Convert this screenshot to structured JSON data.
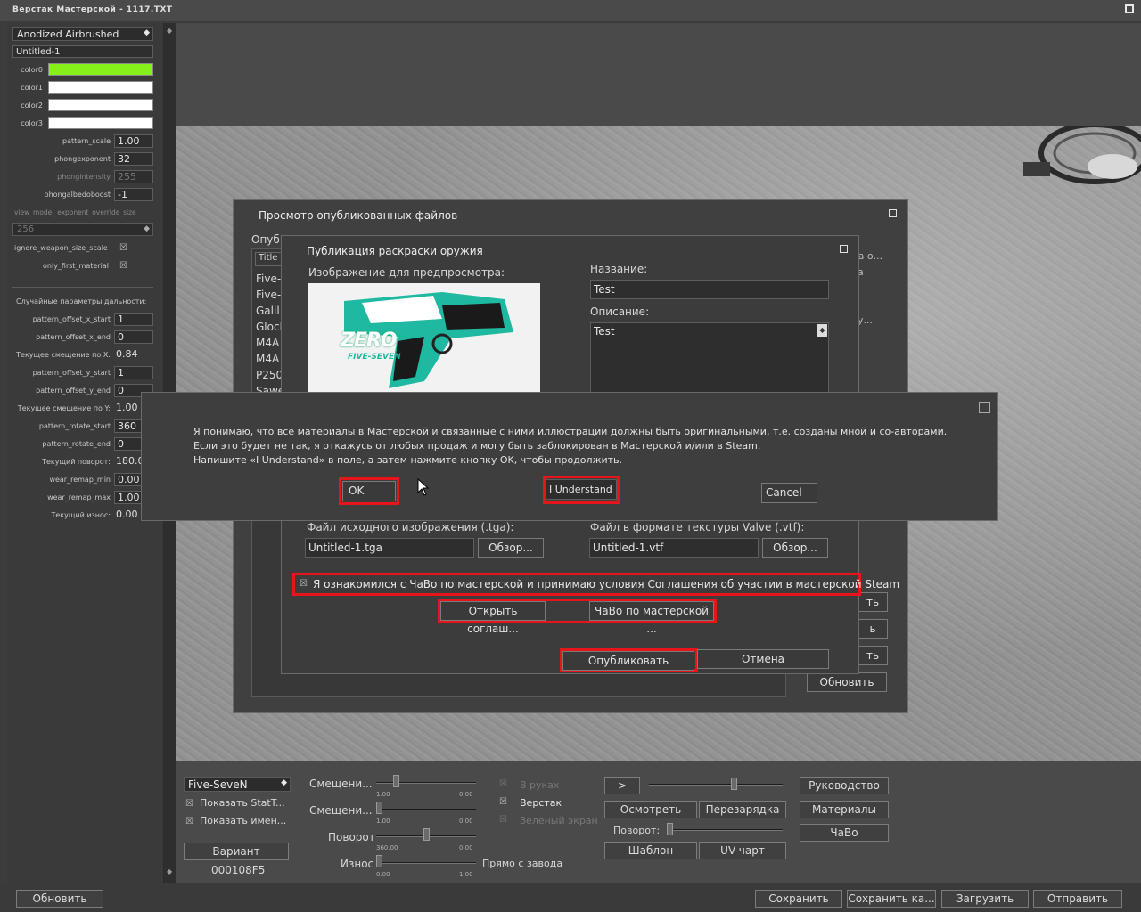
{
  "window": {
    "title": "Верстак Мастерской - 1117.TXT"
  },
  "left_panel": {
    "finish_style": "Anodized Airbrushed",
    "file_name": "Untitled-1",
    "colors": [
      {
        "label": "color0",
        "hex": "#86f01a"
      },
      {
        "label": "color1",
        "hex": "#ffffff"
      },
      {
        "label": "color2",
        "hex": "#ffffff"
      },
      {
        "label": "color3",
        "hex": "#ffffff"
      }
    ],
    "params": [
      {
        "label": "pattern_scale",
        "value": "1.00"
      },
      {
        "label": "phongexponent",
        "value": "32"
      },
      {
        "label": "phongintensity",
        "value": "255"
      },
      {
        "label": "phongalbedoboost",
        "value": "-1"
      }
    ],
    "view_model_label": "view_model_exponent_override_size",
    "view_model_value": "256",
    "ignore_label": "ignore_weapon_size_scale",
    "only_first_label": "only_first_material",
    "random_header": "Случайные параметры дальности:",
    "ranges": [
      {
        "label": "pattern_offset_x_start",
        "value": "1",
        "kind": "field"
      },
      {
        "label": "pattern_offset_x_end",
        "value": "0",
        "kind": "field"
      },
      {
        "label": "Текущее смещение по X:",
        "value": "0.84",
        "kind": "text"
      },
      {
        "label": "pattern_offset_y_start",
        "value": "1",
        "kind": "field"
      },
      {
        "label": "pattern_offset_y_end",
        "value": "0",
        "kind": "field"
      },
      {
        "label": "Текущее смещение по Y:",
        "value": "1.00",
        "kind": "text"
      },
      {
        "label": "pattern_rotate_start",
        "value": "360",
        "kind": "field"
      },
      {
        "label": "pattern_rotate_end",
        "value": "0",
        "kind": "field"
      },
      {
        "label": "Текущий поворот:",
        "value": "180.0",
        "kind": "text"
      },
      {
        "label": "wear_remap_min",
        "value": "0.00",
        "kind": "field"
      },
      {
        "label": "wear_remap_max",
        "value": "1.00",
        "kind": "field"
      },
      {
        "label": "Текущий износ:",
        "value": "0.00",
        "kind": "text"
      }
    ]
  },
  "published_dialog": {
    "title": "Просмотр опубликованных файлов",
    "partial_label": "Опуб",
    "column_title": "Title",
    "rows": [
      "Five-",
      "Five-",
      "Galil",
      "Glock",
      "M4A",
      "M4A",
      "P250",
      "Sawe"
    ],
    "right_text_1": "ка о...",
    "right_text_2": "а",
    "right_text_3": "у...",
    "side_btns": [
      "ть",
      "ь",
      "ть"
    ],
    "update_btn": "Обновить"
  },
  "publish_dialog": {
    "title": "Публикация раскраски оружия",
    "preview_label": "Изображение для предпросмотра:",
    "preview_logo": "ZERO",
    "preview_sub": "FIVE-SEVEN",
    "name_label": "Название:",
    "name_value": "Test",
    "desc_label": "Описание:",
    "desc_value": "Test",
    "source_label": "Файл исходного изображения (.tga):",
    "source_value": "Untitled-1.tga",
    "browse": "Обзор...",
    "vtf_label": "Файл в формате текстуры Valve (.vtf):",
    "vtf_value": "Untitled-1.vtf",
    "agree_text": "Я ознакомился с ЧаВо по мастерской и принимаю условия Соглашения об участии в мастерской Steam",
    "open_agreement": "Открыть соглаш...",
    "faq": "ЧаВо по мастерской ...",
    "publish": "Опубликовать",
    "cancel": "Отмена"
  },
  "confirm_dialog": {
    "line1": "Я понимаю, что все материалы в Мастерской и связанные с ними иллюстрации должны быть оригинальными, т.е. созданы мной и со-авторами.",
    "line2": "Если это будет не так, я откажусь от любых продаж и могу быть заблокирован в Мастерской и/или в Steam.",
    "line3": "Напишите «I Understand» в поле, а затем нажмите кнопку OK, чтобы продолжить.",
    "ok": "OK",
    "input_value": "I Understand",
    "cancel": "Cancel"
  },
  "bottom": {
    "weapon": "Five-SeveN",
    "show_stattrak": "Показать StatT...",
    "show_name": "Показать имен...",
    "variant_btn": "Вариант",
    "variant_code": "000108F5",
    "sliders": [
      {
        "label": "Смещени...",
        "min": "1.00",
        "max": "0.00",
        "level": 0.18
      },
      {
        "label": "Смещени...",
        "min": "1.00",
        "max": "0.00",
        "level": 0.0
      },
      {
        "label": "Поворот",
        "min": "360.00",
        "max": "0.00",
        "level": 0.5
      },
      {
        "label": "Износ",
        "min": "0.00",
        "max": "1.00",
        "level": 0.0
      }
    ],
    "factory_new": "Прямо с завода",
    "modes": [
      {
        "label": "В руках",
        "active": false
      },
      {
        "label": "Верстак",
        "active": true
      },
      {
        "label": "Зеленый экран",
        "active": false
      }
    ],
    "play_btn": ">",
    "inspect": "Осмотреть",
    "reload": "Перезарядка",
    "rotation_label": "Поворот:",
    "template": "Шаблон",
    "uv_chart": "UV-чарт",
    "guide": "Руководство",
    "materials": "Материалы",
    "faq": "ЧаВо"
  },
  "footer": {
    "refresh": "Обновить",
    "save": "Сохранить",
    "save_as": "Сохранить ка...",
    "load": "Загрузить",
    "submit": "Отправить"
  }
}
